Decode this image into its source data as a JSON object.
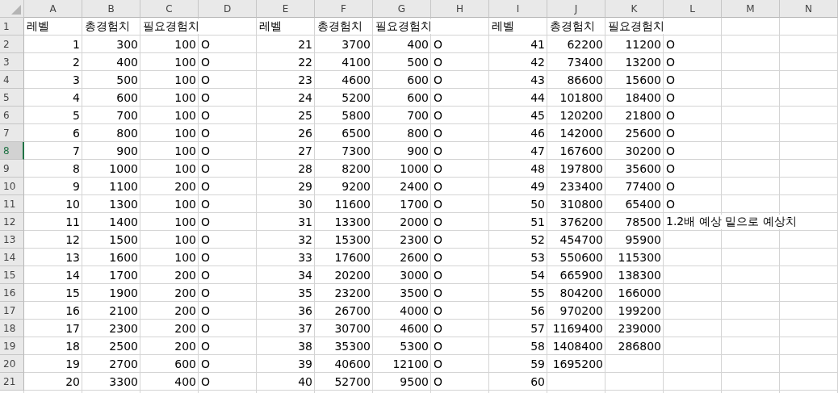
{
  "columns": [
    {
      "label": "A",
      "kind": "number"
    },
    {
      "label": "B",
      "kind": "number"
    },
    {
      "label": "C",
      "kind": "number"
    },
    {
      "label": "D",
      "kind": "text"
    },
    {
      "label": "E",
      "kind": "number"
    },
    {
      "label": "F",
      "kind": "number"
    },
    {
      "label": "G",
      "kind": "number"
    },
    {
      "label": "H",
      "kind": "text"
    },
    {
      "label": "I",
      "kind": "number"
    },
    {
      "label": "J",
      "kind": "number"
    },
    {
      "label": "K",
      "kind": "number"
    },
    {
      "label": "L",
      "kind": "text"
    },
    {
      "label": "M",
      "kind": "text"
    },
    {
      "label": "N",
      "kind": "text"
    }
  ],
  "rows": [
    {
      "number": "1",
      "kind": "header",
      "selected": false,
      "cells": [
        "레벨",
        "총경험치",
        "필요경험치",
        null,
        "레벨",
        "총경험치",
        "필요경험치",
        null,
        "레벨",
        "총경험치",
        "필요경험치"
      ]
    },
    {
      "number": "2",
      "kind": "data",
      "selected": false,
      "cells": [
        "1",
        "300",
        "100",
        "O",
        "21",
        "3700",
        "400",
        "O",
        "41",
        "62200",
        "11200",
        "O"
      ]
    },
    {
      "number": "3",
      "kind": "data",
      "selected": false,
      "cells": [
        "2",
        "400",
        "100",
        "O",
        "22",
        "4100",
        "500",
        "O",
        "42",
        "73400",
        "13200",
        "O"
      ]
    },
    {
      "number": "4",
      "kind": "data",
      "selected": false,
      "cells": [
        "3",
        "500",
        "100",
        "O",
        "23",
        "4600",
        "600",
        "O",
        "43",
        "86600",
        "15600",
        "O"
      ]
    },
    {
      "number": "5",
      "kind": "data",
      "selected": false,
      "cells": [
        "4",
        "600",
        "100",
        "O",
        "24",
        "5200",
        "600",
        "O",
        "44",
        "101800",
        "18400",
        "O"
      ]
    },
    {
      "number": "6",
      "kind": "data",
      "selected": false,
      "cells": [
        "5",
        "700",
        "100",
        "O",
        "25",
        "5800",
        "700",
        "O",
        "45",
        "120200",
        "21800",
        "O"
      ]
    },
    {
      "number": "7",
      "kind": "data",
      "selected": false,
      "cells": [
        "6",
        "800",
        "100",
        "O",
        "26",
        "6500",
        "800",
        "O",
        "46",
        "142000",
        "25600",
        "O"
      ]
    },
    {
      "number": "8",
      "kind": "data",
      "selected": true,
      "cells": [
        "7",
        "900",
        "100",
        "O",
        "27",
        "7300",
        "900",
        "O",
        "47",
        "167600",
        "30200",
        "O"
      ]
    },
    {
      "number": "9",
      "kind": "data",
      "selected": false,
      "cells": [
        "8",
        "1000",
        "100",
        "O",
        "28",
        "8200",
        "1000",
        "O",
        "48",
        "197800",
        "35600",
        "O"
      ]
    },
    {
      "number": "10",
      "kind": "data",
      "selected": false,
      "cells": [
        "9",
        "1100",
        "200",
        "O",
        "29",
        "9200",
        "2400",
        "O",
        "49",
        "233400",
        "77400",
        "O"
      ]
    },
    {
      "number": "11",
      "kind": "data",
      "selected": false,
      "cells": [
        "10",
        "1300",
        "100",
        "O",
        "30",
        "11600",
        "1700",
        "O",
        "50",
        "310800",
        "65400",
        "O"
      ]
    },
    {
      "number": "12",
      "kind": "data",
      "selected": false,
      "cells": [
        "11",
        "1400",
        "100",
        "O",
        "31",
        "13300",
        "2000",
        "O",
        "51",
        "376200",
        "78500",
        "1.2배 예상 밑으로 예상치"
      ]
    },
    {
      "number": "13",
      "kind": "data",
      "selected": false,
      "cells": [
        "12",
        "1500",
        "100",
        "O",
        "32",
        "15300",
        "2300",
        "O",
        "52",
        "454700",
        "95900"
      ]
    },
    {
      "number": "14",
      "kind": "data",
      "selected": false,
      "cells": [
        "13",
        "1600",
        "100",
        "O",
        "33",
        "17600",
        "2600",
        "O",
        "53",
        "550600",
        "115300"
      ]
    },
    {
      "number": "15",
      "kind": "data",
      "selected": false,
      "cells": [
        "14",
        "1700",
        "200",
        "O",
        "34",
        "20200",
        "3000",
        "O",
        "54",
        "665900",
        "138300"
      ]
    },
    {
      "number": "16",
      "kind": "data",
      "selected": false,
      "cells": [
        "15",
        "1900",
        "200",
        "O",
        "35",
        "23200",
        "3500",
        "O",
        "55",
        "804200",
        "166000"
      ]
    },
    {
      "number": "17",
      "kind": "data",
      "selected": false,
      "cells": [
        "16",
        "2100",
        "200",
        "O",
        "36",
        "26700",
        "4000",
        "O",
        "56",
        "970200",
        "199200"
      ]
    },
    {
      "number": "18",
      "kind": "data",
      "selected": false,
      "cells": [
        "17",
        "2300",
        "200",
        "O",
        "37",
        "30700",
        "4600",
        "O",
        "57",
        "1169400",
        "239000"
      ]
    },
    {
      "number": "19",
      "kind": "data",
      "selected": false,
      "cells": [
        "18",
        "2500",
        "200",
        "O",
        "38",
        "35300",
        "5300",
        "O",
        "58",
        "1408400",
        "286800"
      ]
    },
    {
      "number": "20",
      "kind": "data",
      "selected": false,
      "cells": [
        "19",
        "2700",
        "600",
        "O",
        "39",
        "40600",
        "12100",
        "O",
        "59",
        "1695200"
      ]
    },
    {
      "number": "21",
      "kind": "data",
      "selected": false,
      "cells": [
        "20",
        "3300",
        "400",
        "O",
        "40",
        "52700",
        "9500",
        "O",
        "60"
      ]
    }
  ]
}
